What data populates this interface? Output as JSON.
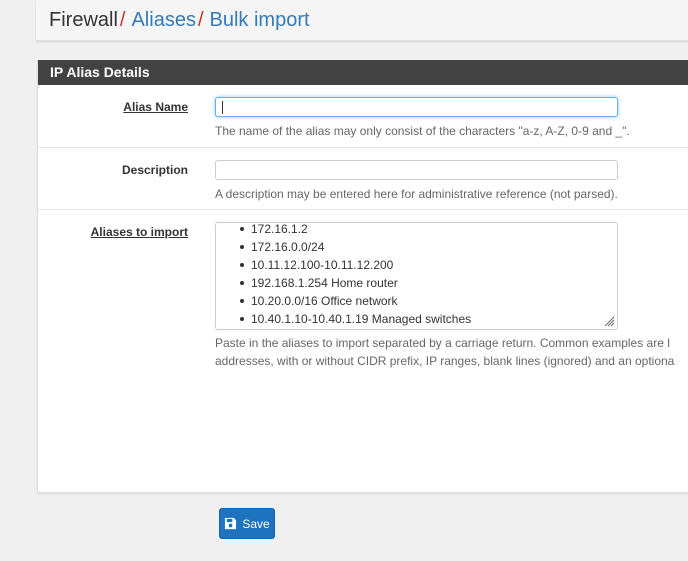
{
  "breadcrumb": {
    "root": "Firewall",
    "sep": "/",
    "items": [
      "Aliases",
      "Bulk import"
    ]
  },
  "panel": {
    "title": "IP Alias Details",
    "alias_name": {
      "label": "Alias Name",
      "value": "",
      "help": "The name of the alias may only consist of the characters \"a-z, A-Z, 0-9 and _\"."
    },
    "description": {
      "label": "Description",
      "value": "",
      "help": "A description may be entered here for administrative reference (not parsed)."
    },
    "aliases_to_import": {
      "label": "Aliases to import",
      "value": "",
      "help_line1": "Paste in the aliases to import separated by a carriage return. Common examples are l",
      "help_line2": "addresses, with or without CIDR prefix, IP ranges, blank lines (ignored) and an optiona",
      "examples": [
        "172.16.1.2",
        "172.16.0.0/24",
        "10.11.12.100-10.11.12.200",
        "192.168.1.254 Home router",
        "10.20.0.0/16 Office network",
        "10.40.1.10-10.40.1.19 Managed switches"
      ]
    }
  },
  "save_button": {
    "label": "Save",
    "icon": "save-icon"
  },
  "colors": {
    "accent": "#1e73be",
    "link": "#337ab7",
    "separator": "#c9302c",
    "panel_header": "#424242"
  }
}
